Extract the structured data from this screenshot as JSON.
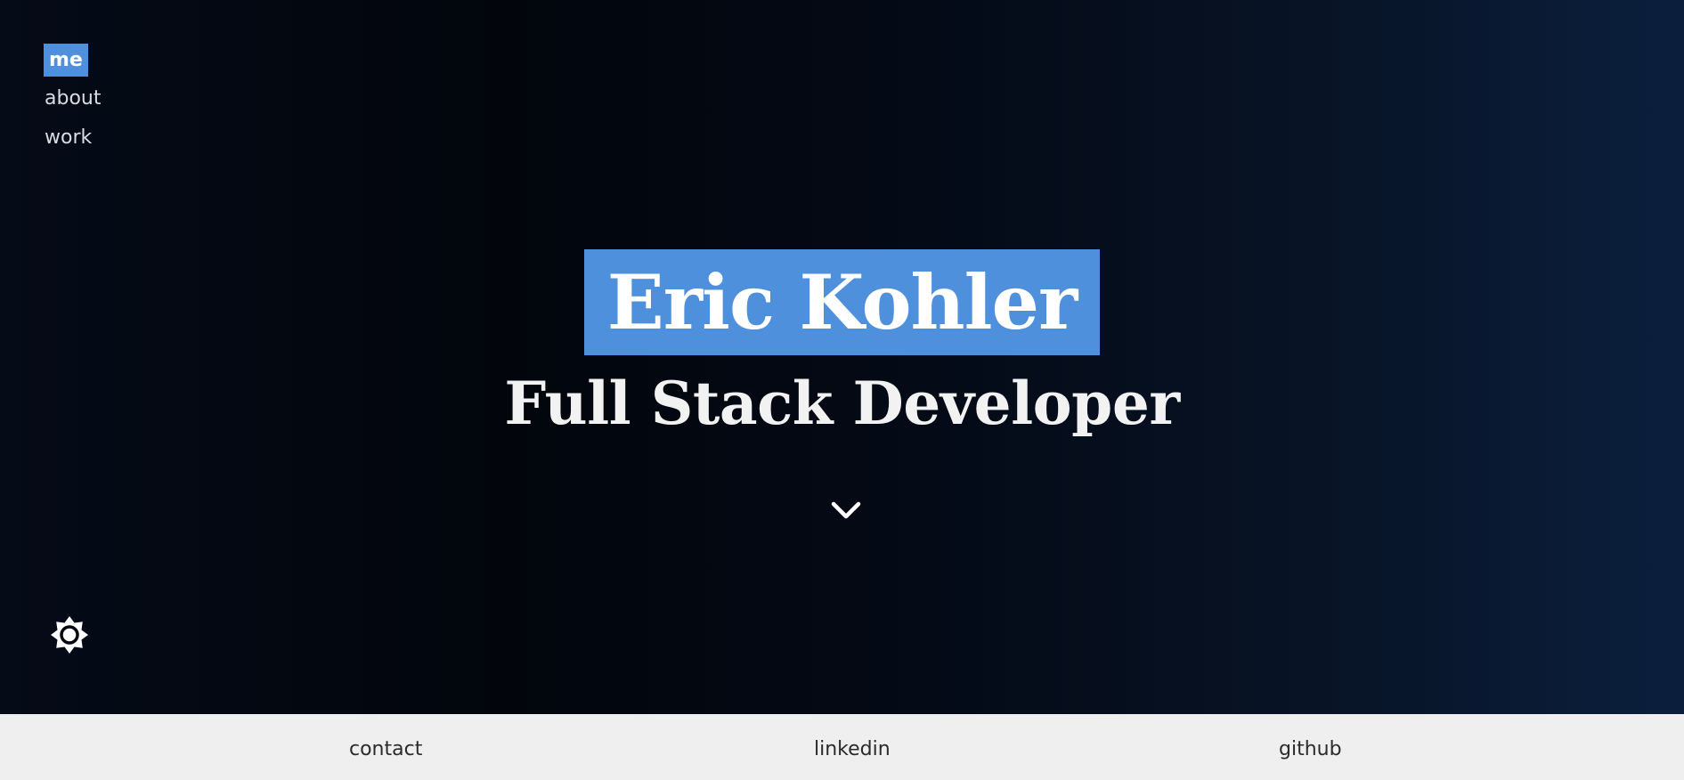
{
  "nav": {
    "items": [
      {
        "label": "me",
        "active": true
      },
      {
        "label": "about",
        "active": false
      },
      {
        "label": "work",
        "active": false
      }
    ]
  },
  "hero": {
    "name": "Eric Kohler",
    "role": "Full Stack Developer",
    "scroll_icon": "chevron-down-icon",
    "theme_icon": "sun-icon"
  },
  "footer": {
    "links": [
      {
        "label": "contact"
      },
      {
        "label": "linkedin"
      },
      {
        "label": "github"
      }
    ]
  },
  "colors": {
    "accent": "#4f90dc",
    "footer_bg": "#efefef",
    "footer_text": "#2b2b2b"
  }
}
